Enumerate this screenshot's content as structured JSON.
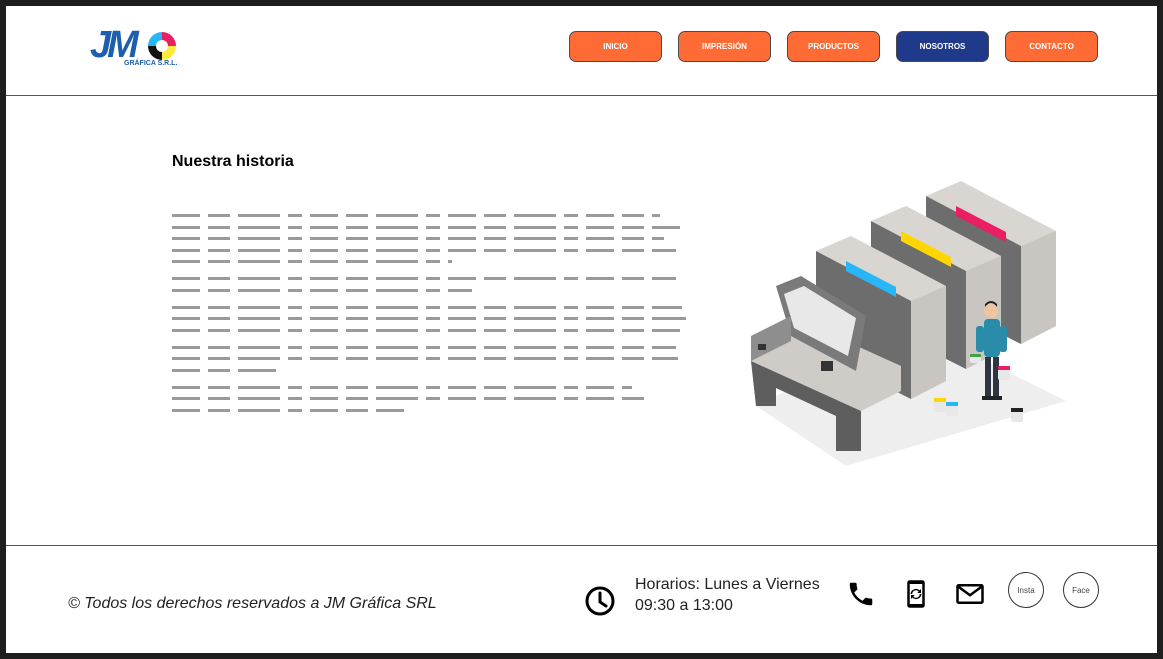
{
  "brand": {
    "logo_text": "JM",
    "logo_sub": "GRÁFICA S.R.L."
  },
  "nav": {
    "items": [
      {
        "label": "INICIO"
      },
      {
        "label": "IMPRESIÓN"
      },
      {
        "label": "PRODUCTOS"
      },
      {
        "label": "NOSOTROS"
      },
      {
        "label": "CONTACTO"
      }
    ],
    "active": "NOSOTROS",
    "colors": {
      "default": "#ff6b35",
      "active": "#1f3a8a"
    }
  },
  "main": {
    "title": "Nuestra historia",
    "illustration": "offset-printing-press-icon"
  },
  "footer": {
    "copyright": "© Todos los derechos reservados a JM Gráfica SRL",
    "hours_line1": "Horarios: Lunes a Viernes",
    "hours_line2": "09:30 a 13:00",
    "social": {
      "insta": "Insta",
      "face": "Face"
    },
    "icons": [
      "clock-icon",
      "phone-icon",
      "mobile-sync-icon",
      "mail-icon"
    ]
  }
}
